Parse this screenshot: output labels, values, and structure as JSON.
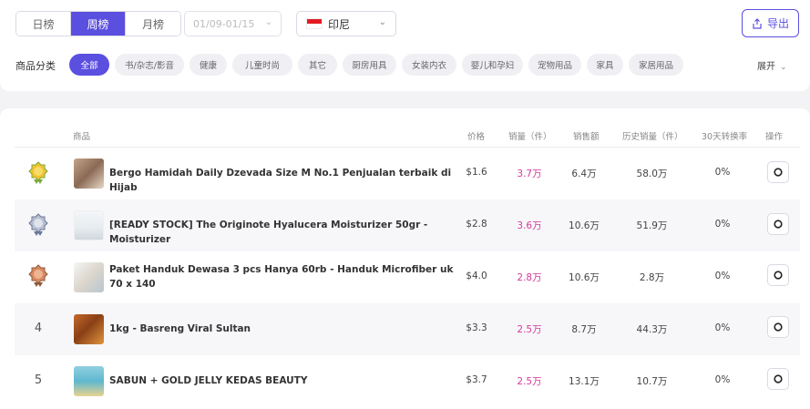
{
  "range_tabs": [
    {
      "label": "日榜",
      "active": false
    },
    {
      "label": "周榜",
      "active": true
    },
    {
      "label": "月榜",
      "active": false
    }
  ],
  "date_range": "01/09-01/15",
  "country": "印尼",
  "export_label": "导出",
  "category_label": "商品分类",
  "categories": [
    {
      "label": "全部",
      "active": true
    },
    {
      "label": "书/杂志/影音",
      "active": false
    },
    {
      "label": "健康",
      "active": false
    },
    {
      "label": "儿童时尚",
      "active": false
    },
    {
      "label": "其它",
      "active": false
    },
    {
      "label": "厨房用具",
      "active": false
    },
    {
      "label": "女装内衣",
      "active": false
    },
    {
      "label": "婴儿和孕妇",
      "active": false
    },
    {
      "label": "宠物用品",
      "active": false
    },
    {
      "label": "家具",
      "active": false
    },
    {
      "label": "家居用品",
      "active": false
    }
  ],
  "expand_label": "展开",
  "columns": {
    "product": "商品",
    "price": "价格",
    "sales": "销量（件）",
    "revenue": "销售额",
    "total_sales": "历史销量（件）",
    "conversion": "30天转换率",
    "action": "操作"
  },
  "rows": [
    {
      "rank": "1",
      "name": "Bergo Hamidah Daily Dzevada Size M No.1 Penjualan terbaik di Hijab",
      "price": "$1.6",
      "sales": "3.7万",
      "revenue": "6.4万",
      "total_sales": "58.0万",
      "conversion": "0%"
    },
    {
      "rank": "2",
      "name": "[READY STOCK] The Originote Hyalucera Moisturizer 50gr - Moisturizer",
      "price": "$2.8",
      "sales": "3.6万",
      "revenue": "10.6万",
      "total_sales": "51.9万",
      "conversion": "0%"
    },
    {
      "rank": "3",
      "name": "Paket Handuk Dewasa 3 pcs Hanya 60rb - Handuk Microfiber uk 70 x 140",
      "price": "$4.0",
      "sales": "2.8万",
      "revenue": "10.6万",
      "total_sales": "2.8万",
      "conversion": "0%"
    },
    {
      "rank": "4",
      "name": "1kg - Basreng Viral Sultan",
      "price": "$3.3",
      "sales": "2.5万",
      "revenue": "8.7万",
      "total_sales": "44.3万",
      "conversion": "0%"
    },
    {
      "rank": "5",
      "name": "SABUN + GOLD JELLY KEDAS BEAUTY",
      "price": "$3.7",
      "sales": "2.5万",
      "revenue": "13.1万",
      "total_sales": "10.7万",
      "conversion": "0%"
    }
  ],
  "colors": {
    "accent": "#5b4fe0",
    "sales": "#d33b9b"
  }
}
